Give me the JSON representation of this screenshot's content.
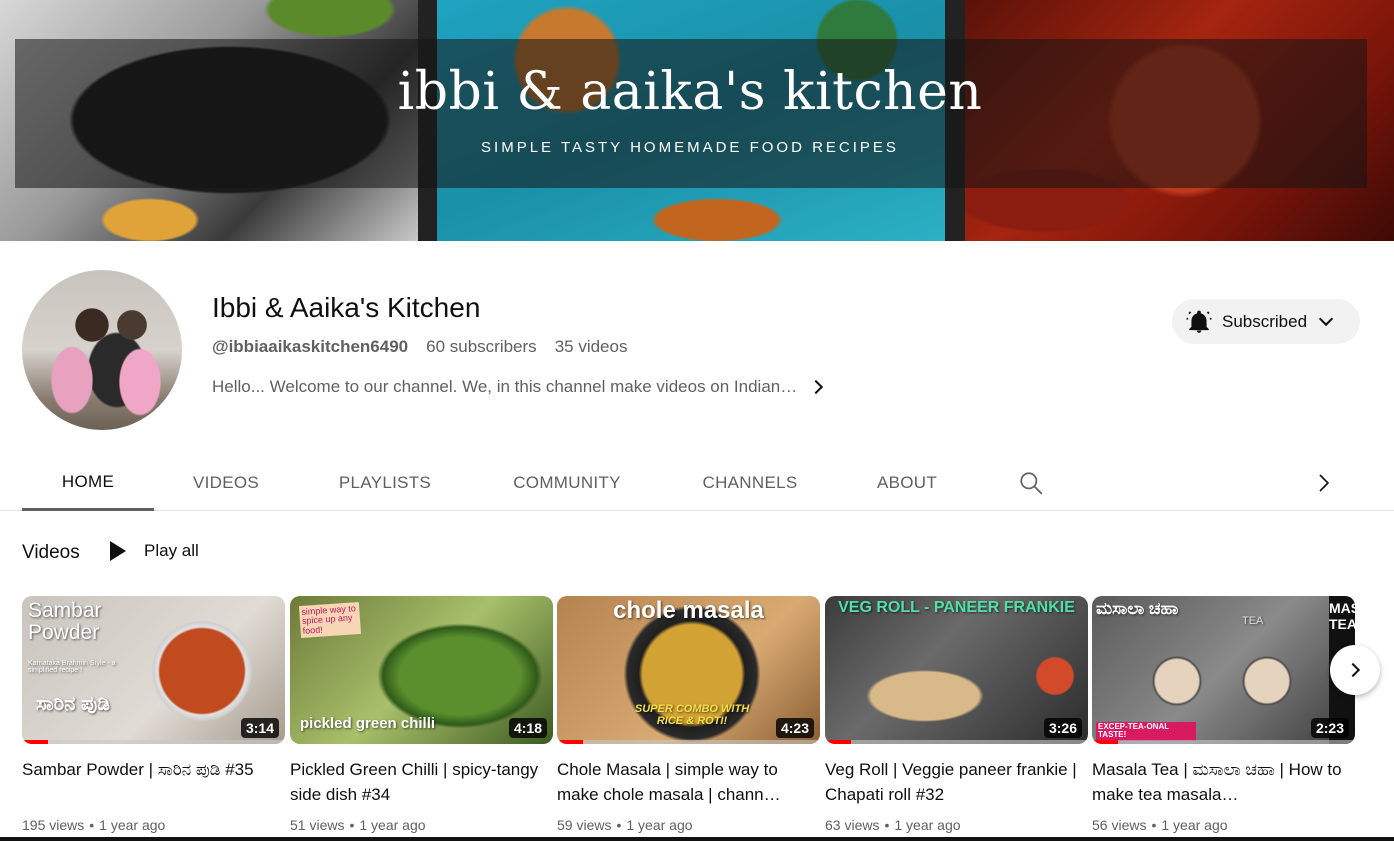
{
  "banner": {
    "title": "ibbi & aaika's kitchen",
    "subtitle": "SIMPLE TASTY HOMEMADE FOOD RECIPES"
  },
  "channel": {
    "name": "Ibbi & Aaika's Kitchen",
    "handle": "@ibbiaaikaskitchen6490",
    "subscribers": "60 subscribers",
    "videos": "35 videos",
    "description": "Hello... Welcome to our channel. We, in this channel make videos on Indian…"
  },
  "subscribe": {
    "label": "Subscribed"
  },
  "tabs": [
    {
      "label": "HOME",
      "active": true
    },
    {
      "label": "VIDEOS"
    },
    {
      "label": "PLAYLISTS"
    },
    {
      "label": "COMMUNITY"
    },
    {
      "label": "CHANNELS"
    },
    {
      "label": "ABOUT"
    }
  ],
  "section": {
    "title": "Videos",
    "play_all": "Play all"
  },
  "videos": [
    {
      "title": "Sambar Powder | ಸಾರಿನ ಪುಡಿ #35",
      "views": "195 views",
      "age": "1 year ago",
      "duration": "3:14",
      "progress": 0.1,
      "thumb_text": "Sambar Powder",
      "thumb_small": "Karnataka Brahmin Style - a simplified recipe !",
      "thumb_text2": "ಸಾರಿನ ಪುಡಿ"
    },
    {
      "title": "Pickled Green Chilli | spicy-tangy side dish #34",
      "views": "51 views",
      "age": "1 year ago",
      "duration": "4:18",
      "progress": 0,
      "thumb_text": "pickled green chilli",
      "thumb_small": "simple way to spice up any food!"
    },
    {
      "title": "Chole Masala | simple way to make chole masala | chann…",
      "views": "59 views",
      "age": "1 year ago",
      "duration": "4:23",
      "progress": 0.1,
      "thumb_text": "chole masala",
      "thumb_text2": "SUPER COMBO WITH RICE & ROTI!"
    },
    {
      "title": "Veg Roll | Veggie paneer frankie | Chapati roll #32",
      "views": "63 views",
      "age": "1 year ago",
      "duration": "3:26",
      "progress": 0.1,
      "thumb_text": "VEG ROLL - PANEER FRANKIE"
    },
    {
      "title": "Masala Tea | ಮಸಾಲಾ ಚಹಾ | How to make tea masala…",
      "views": "56 views",
      "age": "1 year ago",
      "duration": "2:23",
      "progress": 0.1,
      "thumb_text": "ಮಸಾಲಾ ಚಹಾ",
      "thumb_small": "EXCEP-TEA-ONAL TASTE!",
      "thumb_side": "MASALA TEA",
      "thumb_mug": "TEA"
    }
  ]
}
